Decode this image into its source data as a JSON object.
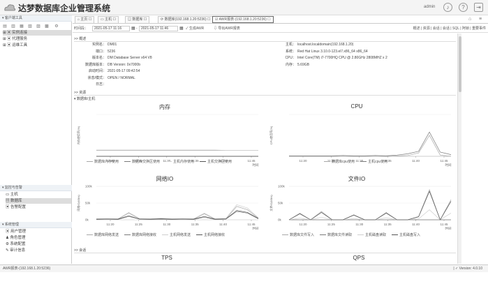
{
  "app": {
    "title": "达梦数据库企业管理系统",
    "user": "admin"
  },
  "sidebar": {
    "panel1": "客户端工具",
    "tree": [
      {
        "label": "实例连接",
        "selected": true
      },
      {
        "label": "代理服务",
        "selected": false
      },
      {
        "label": "运维工具",
        "selected": false
      }
    ],
    "panel2": "监控与告警",
    "monitor": [
      {
        "label": "主机",
        "selected": false
      },
      {
        "label": "数据库",
        "selected": true
      },
      {
        "label": "告警配置",
        "selected": false
      }
    ],
    "panel3": "系统管理",
    "system": [
      {
        "label": "用户管理"
      },
      {
        "label": "角色管理"
      },
      {
        "label": "系统配置"
      },
      {
        "label": "审计信息"
      }
    ]
  },
  "tabs": [
    {
      "label": "主页"
    },
    {
      "label": "主机"
    },
    {
      "label": "数据库"
    },
    {
      "label": "数据库(192.168.1.20:5236)"
    },
    {
      "label": "AWR报表-(192.168.1.20:5236)"
    }
  ],
  "toolbar": {
    "period_label": "时间段：",
    "start": "2021-05-17 11:16",
    "sep": "-",
    "end": "2021-05-17 11:46",
    "generate": "生成AWR",
    "export": "导出AWR报表",
    "links": [
      "概述",
      "资源",
      "会话",
      "会话",
      "SQL",
      "阿锁",
      "重要事件"
    ]
  },
  "overview": {
    "header": "概述",
    "left": [
      {
        "k": "实例名：",
        "v": "DM01"
      },
      {
        "k": "端口：",
        "v": "5236"
      },
      {
        "k": "版本名：",
        "v": "DM Database Server x64 V8"
      },
      {
        "k": "数据库版本：",
        "v": "DB Version: 0x7000b"
      },
      {
        "k": "启动时间：",
        "v": "2021-05-17 09:42:54"
      },
      {
        "k": "状态/模式：",
        "v": "OPEN / NORMAL"
      },
      {
        "k": "日志：",
        "v": ""
      }
    ],
    "right": [
      {
        "k": "主机：",
        "v": "localhost.localdomain(192.168.1.20)"
      },
      {
        "k": "系统：",
        "v": "Red Hat Linux 3.10.0-123.el7.x86_64 x86_64"
      },
      {
        "k": "CPU：",
        "v": "Intel Core(TM) i7-7700HQ CPU @ 2.80GHz 2808MHZ x 2"
      },
      {
        "k": "内存：",
        "v": "5.69GB"
      }
    ]
  },
  "resource": {
    "header": "资源",
    "sub": "数据库/主机"
  },
  "session": {
    "header": "会话"
  },
  "colors": {
    "c1": "#a8a8a8",
    "c2": "#7a7a7a",
    "c3": "#cfcfcf",
    "c4": "#555555"
  },
  "chart_data": [
    {
      "type": "line",
      "title": "内存",
      "ylabel": "内存使用率(%)",
      "categories": [
        "11:20",
        "11:25",
        "11:30",
        "11:35",
        "11:40",
        "11:45"
      ],
      "xlabel": "时间",
      "ylim": [
        0,
        100
      ],
      "series": [
        {
          "name": "数据库内存使用",
          "values": [
            14,
            14,
            14,
            14,
            14,
            14,
            14,
            14,
            14,
            14,
            14,
            14,
            14,
            14,
            14,
            14
          ]
        },
        {
          "name": "数据库交换区使用",
          "values": [
            0,
            0,
            0,
            0,
            0,
            0,
            0,
            0,
            0,
            0,
            0,
            0,
            0,
            0,
            0,
            0
          ]
        },
        {
          "name": "主机内存使用",
          "values": [
            15,
            15,
            15,
            15,
            15,
            15,
            15,
            15,
            15,
            15,
            15,
            15,
            14,
            14,
            14,
            14
          ]
        },
        {
          "name": "主机交换区使用",
          "values": [
            0,
            0,
            0,
            0,
            0,
            0,
            0,
            0,
            0,
            0,
            0,
            0,
            0,
            0,
            0,
            0
          ]
        }
      ]
    },
    {
      "type": "line",
      "title": "CPU",
      "ylabel": "CPU使用率(%)",
      "categories": [
        "11:20",
        "11:25",
        "11:30",
        "11:35",
        "11:40",
        "11:45"
      ],
      "xlabel": "时间",
      "ylim": [
        0,
        100
      ],
      "series": [
        {
          "name": "数据库cpu使用",
          "values": [
            0,
            0,
            0,
            0,
            0,
            0,
            0,
            0,
            0,
            0,
            1,
            2,
            8,
            50,
            3,
            0
          ]
        },
        {
          "name": "主机cpu使用",
          "values": [
            1,
            1,
            1,
            1,
            1,
            2,
            1,
            1,
            2,
            1,
            3,
            6,
            12,
            58,
            10,
            4
          ]
        }
      ]
    },
    {
      "type": "line",
      "title": "网络IO",
      "ylabel": "网络IO(KB/s)",
      "categories": [
        "11:20",
        "11:25",
        "11:30",
        "11:35",
        "11:40",
        "11:45"
      ],
      "xlabel": "时间",
      "ylim": [
        0,
        100
      ],
      "yticks": [
        "0k",
        "50k",
        "100k"
      ],
      "series": [
        {
          "name": "数据库网络发送",
          "values": [
            2,
            3,
            2,
            20,
            3,
            2,
            4,
            2,
            3,
            2,
            18,
            2,
            3,
            40,
            30,
            5
          ]
        },
        {
          "name": "数据库网络接收",
          "values": [
            1,
            2,
            1,
            10,
            2,
            1,
            2,
            1,
            2,
            1,
            8,
            1,
            2,
            25,
            20,
            3
          ]
        },
        {
          "name": "主机网络发送",
          "values": [
            3,
            4,
            3,
            22,
            4,
            3,
            5,
            3,
            4,
            3,
            20,
            3,
            4,
            45,
            35,
            6
          ]
        },
        {
          "name": "主机网络接收",
          "values": [
            2,
            2,
            2,
            12,
            2,
            2,
            3,
            2,
            2,
            2,
            10,
            2,
            3,
            28,
            22,
            4
          ]
        }
      ]
    },
    {
      "type": "line",
      "title": "文件IO",
      "ylabel": "文件IO(KB/s)",
      "categories": [
        "11:20",
        "11:25",
        "11:30",
        "11:35",
        "11:40",
        "11:45"
      ],
      "xlabel": "时间",
      "ylim": [
        0,
        100
      ],
      "yticks": [
        "0k",
        "50k",
        "100k"
      ],
      "series": [
        {
          "name": "数据库文件写入",
          "values": [
            0,
            20,
            0,
            25,
            0,
            0,
            15,
            0,
            0,
            22,
            0,
            0,
            10,
            90,
            0,
            60
          ]
        },
        {
          "name": "数据库文件读取",
          "values": [
            0,
            0,
            0,
            0,
            0,
            0,
            0,
            0,
            0,
            0,
            0,
            0,
            0,
            0,
            0,
            0
          ]
        },
        {
          "name": "主机磁盘读取",
          "values": [
            0,
            5,
            0,
            8,
            0,
            0,
            4,
            0,
            0,
            6,
            0,
            0,
            3,
            30,
            0,
            20
          ]
        },
        {
          "name": "主机磁盘写入",
          "values": [
            0,
            18,
            0,
            22,
            0,
            0,
            14,
            0,
            0,
            20,
            0,
            0,
            9,
            85,
            0,
            55
          ]
        }
      ]
    },
    {
      "type": "line",
      "title": "TPS"
    },
    {
      "type": "line",
      "title": "QPS"
    }
  ],
  "status": {
    "left": "AWR报表-(192.168.1.20:5236)",
    "right": "Version: 4.0.10"
  }
}
